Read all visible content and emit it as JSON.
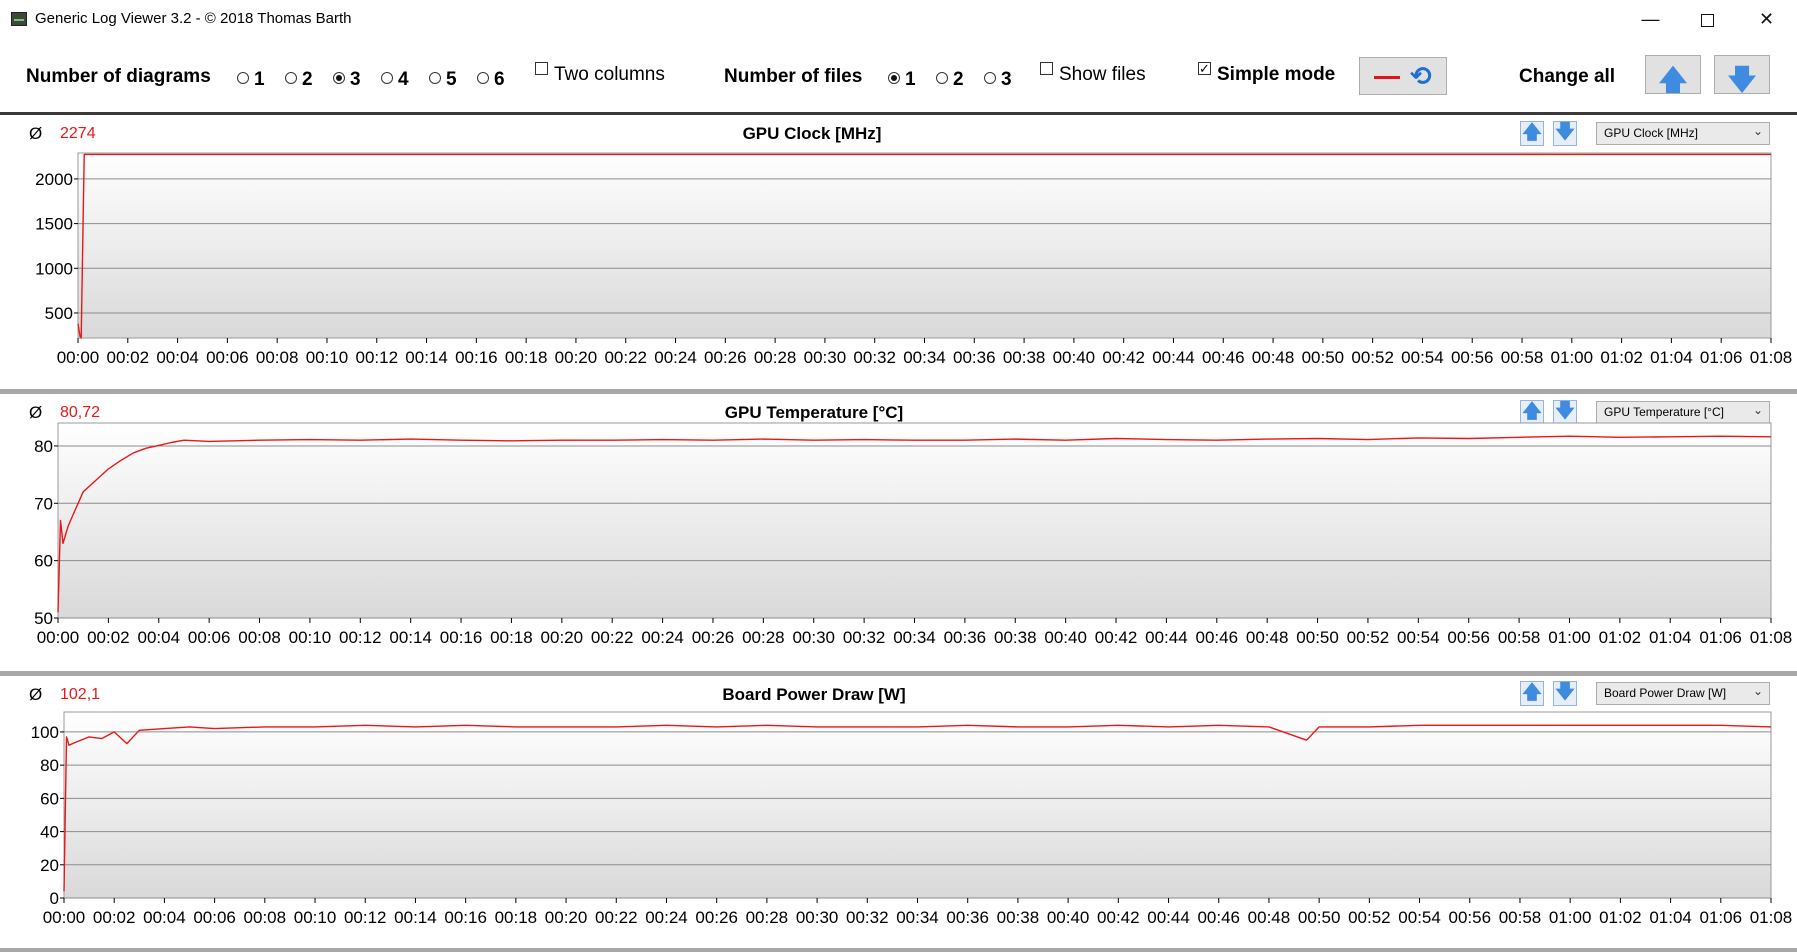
{
  "window": {
    "title": "Generic Log Viewer 3.2 - © 2018 Thomas Barth",
    "minimize_glyph": "—",
    "close_glyph": "✕"
  },
  "toolbar": {
    "num_diagrams_label": "Number of diagrams",
    "num_diagrams_options": [
      "1",
      "2",
      "3",
      "4",
      "5",
      "6"
    ],
    "num_diagrams_selected": "3",
    "two_columns_label": "Two columns",
    "two_columns_checked": false,
    "num_files_label": "Number of files",
    "num_files_options": [
      "1",
      "2",
      "3"
    ],
    "num_files_selected": "1",
    "show_files_label": "Show files",
    "show_files_checked": false,
    "simple_mode_label": "Simple mode",
    "simple_mode_checked": true,
    "check_glyph": "✓",
    "change_all_label": "Change all",
    "up_glyph": "🡅",
    "down_glyph": "🡇",
    "cycle_glyph": "⟲"
  },
  "icons": {
    "app": "app-icon",
    "minimize": "minimize-icon",
    "maximize": "maximize-icon",
    "close": "close-icon",
    "up": "arrow-up-icon",
    "down": "arrow-down-icon",
    "cycle": "refresh-icon",
    "caret": "chevron-down-icon"
  },
  "colors": {
    "series": "#e81818",
    "grid": "#8c8c8c",
    "plot_bg_top": "#ffffff",
    "plot_bg_bottom": "#d9d9d9",
    "accent_blue": "#3e8be0"
  },
  "panels": [
    {
      "avg_symbol": "Ø",
      "avg_value": "2274",
      "title": "GPU Clock [MHz]",
      "combo_value": "GPU Clock [MHz]",
      "caret": "⌄"
    },
    {
      "avg_symbol": "Ø",
      "avg_value": "80,72",
      "title": "GPU Temperature [°C]",
      "combo_value": "GPU Temperature [°C]",
      "caret": "⌄"
    },
    {
      "avg_symbol": "Ø",
      "avg_value": "102,1",
      "title": "Board Power Draw [W]",
      "combo_value": "Board Power Draw [W]",
      "caret": "⌄"
    }
  ],
  "chart_data": [
    {
      "type": "line",
      "title": "GPU Clock [MHz]",
      "x_unit": "minutes",
      "x_tick_labels": [
        "00:00",
        "00:02",
        "00:04",
        "00:06",
        "00:08",
        "00:10",
        "00:12",
        "00:14",
        "00:16",
        "00:18",
        "00:20",
        "00:22",
        "00:24",
        "00:26",
        "00:28",
        "00:30",
        "00:32",
        "00:34",
        "00:36",
        "00:38",
        "00:40",
        "00:42",
        "00:44",
        "00:46",
        "00:48",
        "00:50",
        "00:52",
        "00:54",
        "00:56",
        "00:58",
        "01:00",
        "01:02",
        "01:04",
        "01:06",
        "01:08"
      ],
      "xlim": [
        0,
        68
      ],
      "y_ticks": [
        500,
        1000,
        1500,
        2000
      ],
      "ylim": [
        220,
        2290
      ],
      "grid": true,
      "series": [
        {
          "x": [
            0,
            0.08,
            0.13,
            0.25,
            1,
            20,
            40,
            60,
            68
          ],
          "y": [
            380,
            240,
            220,
            2274,
            2274,
            2274,
            2274,
            2274,
            2274
          ]
        }
      ]
    },
    {
      "type": "line",
      "title": "GPU Temperature [°C]",
      "x_unit": "minutes",
      "x_tick_labels": [
        "00:00",
        "00:02",
        "00:04",
        "00:06",
        "00:08",
        "00:10",
        "00:12",
        "00:14",
        "00:16",
        "00:18",
        "00:20",
        "00:22",
        "00:24",
        "00:26",
        "00:28",
        "00:30",
        "00:32",
        "00:34",
        "00:36",
        "00:38",
        "00:40",
        "00:42",
        "00:44",
        "00:46",
        "00:48",
        "00:50",
        "00:52",
        "00:54",
        "00:56",
        "00:58",
        "01:00",
        "01:02",
        "01:04",
        "01:06",
        "01:08"
      ],
      "xlim": [
        0,
        68
      ],
      "y_ticks": [
        50,
        60,
        70,
        80
      ],
      "ylim": [
        50,
        84
      ],
      "grid": true,
      "series": [
        {
          "x": [
            0,
            0.1,
            0.2,
            0.4,
            0.7,
            1,
            1.5,
            2,
            2.5,
            3,
            3.5,
            4,
            4.5,
            5,
            6,
            8,
            10,
            12,
            14,
            16,
            18,
            20,
            22,
            24,
            26,
            28,
            30,
            32,
            34,
            36,
            38,
            40,
            42,
            44,
            46,
            48,
            50,
            52,
            54,
            56,
            58,
            60,
            62,
            64,
            66,
            68
          ],
          "y": [
            51,
            67,
            63,
            66,
            69,
            72,
            74,
            76,
            77.5,
            78.8,
            79.6,
            80.1,
            80.6,
            81,
            80.8,
            81,
            81.1,
            81,
            81.2,
            81,
            80.9,
            81,
            81,
            81.1,
            81,
            81.2,
            81,
            81.1,
            81,
            81,
            81.2,
            81,
            81.3,
            81.1,
            81,
            81.2,
            81.3,
            81.1,
            81.4,
            81.3,
            81.5,
            81.7,
            81.5,
            81.6,
            81.7,
            81.6
          ]
        }
      ]
    },
    {
      "type": "line",
      "title": "Board Power Draw [W]",
      "x_unit": "minutes",
      "x_tick_labels": [
        "00:00",
        "00:02",
        "00:04",
        "00:06",
        "00:08",
        "00:10",
        "00:12",
        "00:14",
        "00:16",
        "00:18",
        "00:20",
        "00:22",
        "00:24",
        "00:26",
        "00:28",
        "00:30",
        "00:32",
        "00:34",
        "00:36",
        "00:38",
        "00:40",
        "00:42",
        "00:44",
        "00:46",
        "00:48",
        "00:50",
        "00:52",
        "00:54",
        "00:56",
        "00:58",
        "01:00",
        "01:02",
        "01:04",
        "01:06",
        "01:08"
      ],
      "xlim": [
        0,
        68
      ],
      "y_ticks": [
        0,
        20,
        40,
        60,
        80,
        100
      ],
      "ylim": [
        0,
        112
      ],
      "grid": true,
      "series": [
        {
          "x": [
            0,
            0.1,
            0.2,
            0.5,
            1,
            1.5,
            2,
            2.5,
            3,
            4,
            5,
            6,
            8,
            10,
            12,
            14,
            16,
            18,
            20,
            22,
            24,
            26,
            28,
            30,
            32,
            34,
            36,
            38,
            40,
            42,
            44,
            46,
            48,
            49.5,
            50,
            52,
            54,
            56,
            58,
            60,
            62,
            64,
            66,
            68
          ],
          "y": [
            4,
            97,
            92,
            94,
            97,
            96,
            100,
            93,
            101,
            102,
            103,
            102,
            103,
            103,
            104,
            103,
            104,
            103,
            103,
            103,
            104,
            103,
            104,
            103,
            103,
            103,
            104,
            103,
            103,
            104,
            103,
            104,
            103,
            95,
            103,
            103,
            104,
            104,
            104,
            104,
            104,
            104,
            104,
            103
          ]
        }
      ]
    }
  ]
}
